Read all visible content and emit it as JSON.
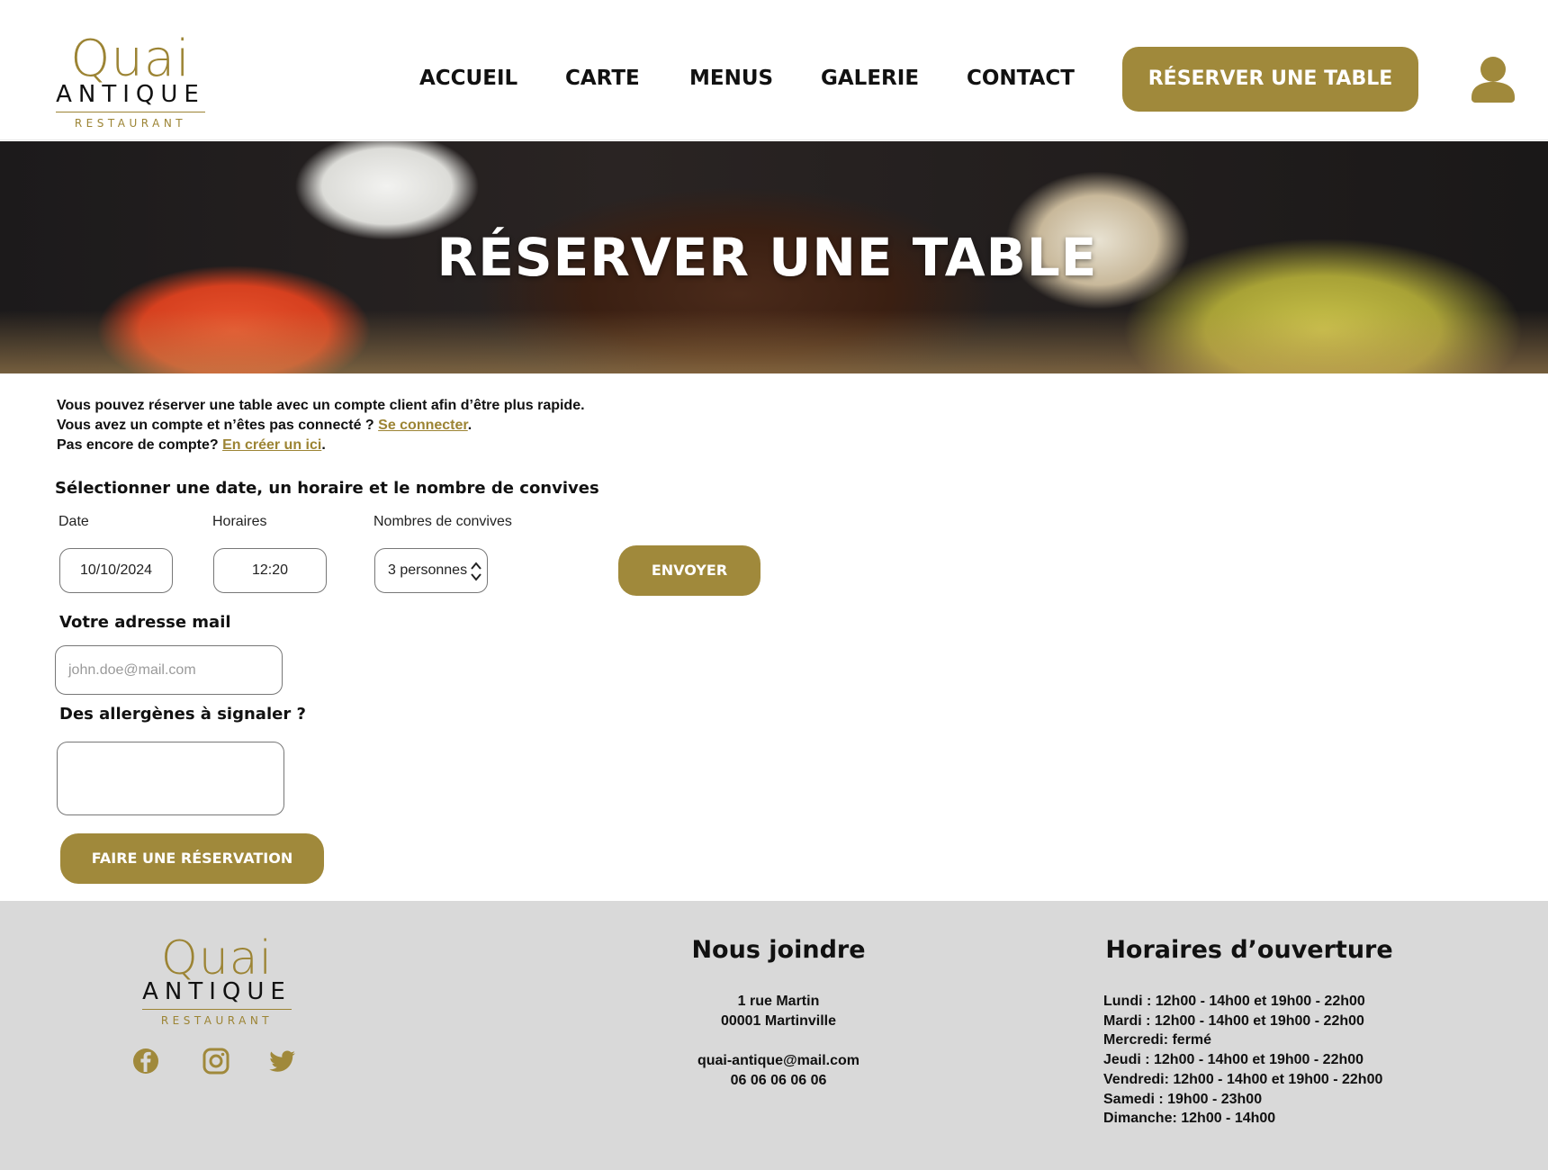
{
  "brand": {
    "name": "Quai",
    "sub": "ANTIQUE",
    "tag": "RESTAURANT",
    "color": "#a0893b"
  },
  "nav": {
    "items": [
      "ACCUEIL",
      "CARTE",
      "MENUS",
      "GALERIE",
      "CONTACT"
    ],
    "cta": "RÉSERVER UNE TABLE"
  },
  "hero": {
    "title": "RÉSERVER UNE TABLE"
  },
  "intro": {
    "line1": "Vous pouvez réserver une table avec un compte client afin d’être plus rapide.",
    "line2_prefix": "Vous avez un compte et n’êtes pas connecté ? ",
    "login_link": "Se connecter",
    "line3_prefix": "Pas encore de compte? ",
    "signup_link": "En créer un ici",
    "dot": "."
  },
  "form": {
    "section_title": "Sélectionner une date, un horaire et le nombre de convives",
    "date_label": "Date",
    "date_value": "10/10/2024",
    "time_label": "Horaires",
    "time_value": "12:20",
    "guests_label": "Nombres de convives",
    "guests_value": "3 personnes",
    "send_button": "ENVOYER",
    "email_title": "Votre adresse mail",
    "email_placeholder": "john.doe@mail.com",
    "allergens_title": "Des allergènes à signaler ?",
    "submit_button": "FAIRE UNE RÉSERVATION"
  },
  "footer": {
    "contact_title": "Nous joindre",
    "address1": "1 rue Martin",
    "address2": "00001 Martinville",
    "email": "quai-antique@mail.com",
    "phone": "06 06 06 06 06",
    "hours_title": "Horaires d’ouverture",
    "hours": [
      "Lundi : 12h00 - 14h00 et 19h00 - 22h00",
      "Mardi : 12h00 - 14h00 et 19h00 - 22h00",
      "Mercredi: fermé",
      "Jeudi : 12h00 - 14h00 et 19h00 - 22h00",
      "Vendredi: 12h00 - 14h00 et 19h00 - 22h00",
      "Samedi : 19h00 - 23h00",
      "Dimanche: 12h00 - 14h00"
    ],
    "social_icons": [
      "facebook-icon",
      "instagram-icon",
      "twitter-icon"
    ]
  }
}
